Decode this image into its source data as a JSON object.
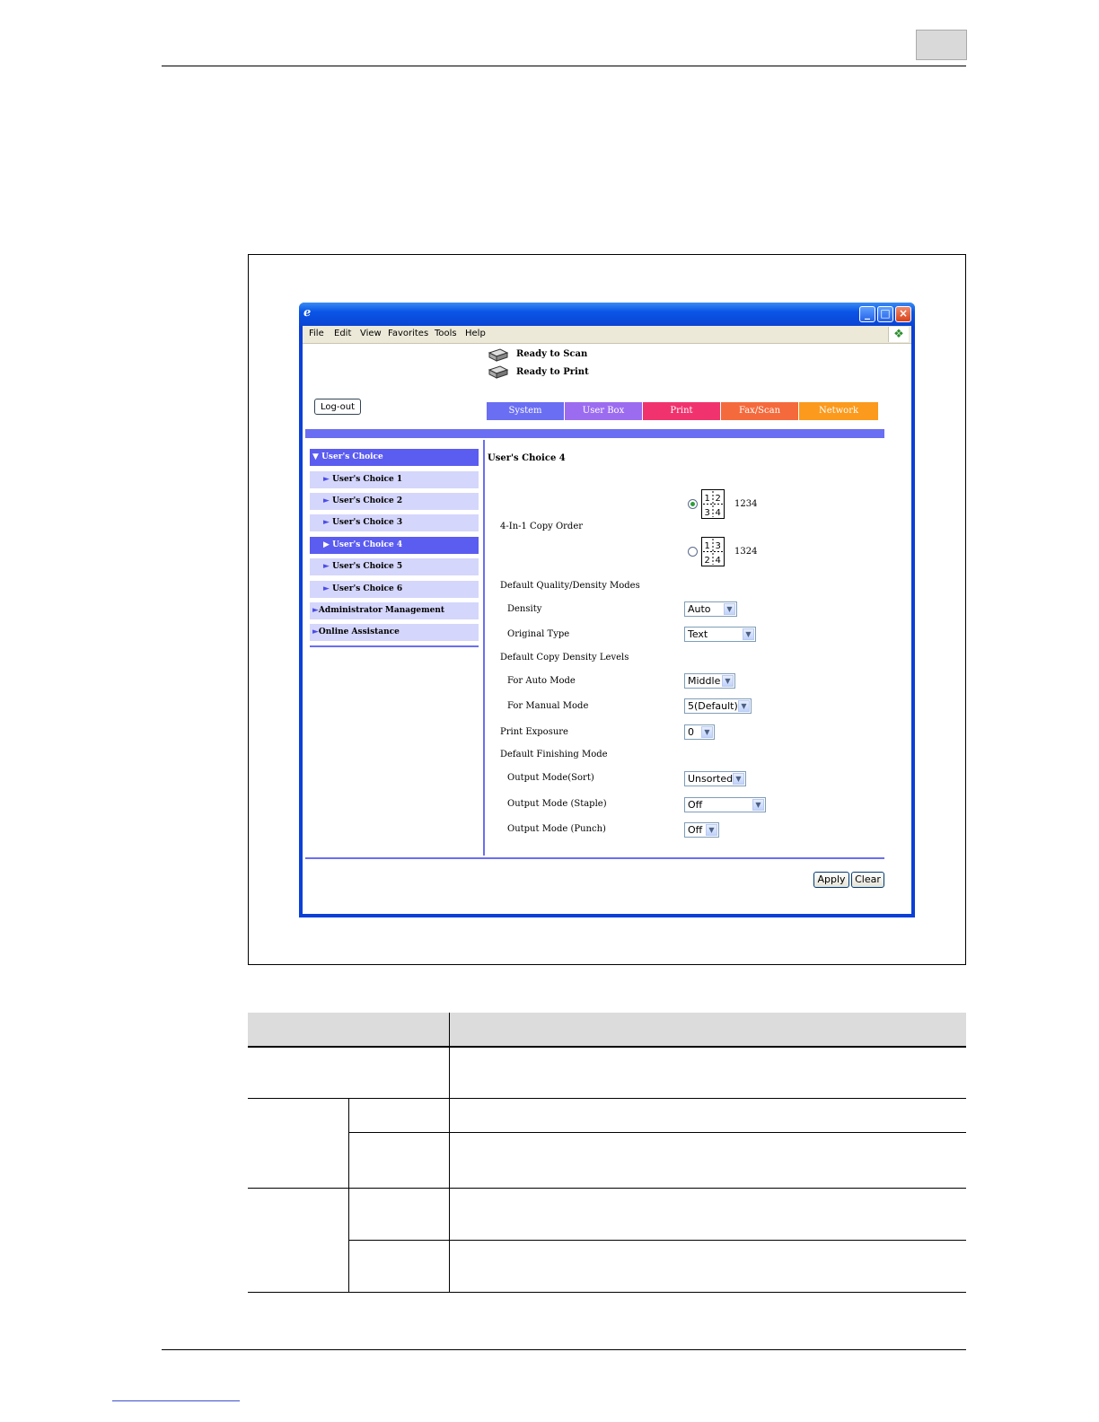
{
  "browser": {
    "menu": [
      "File",
      "Edit",
      "View",
      "Favorites",
      "Tools",
      "Help"
    ]
  },
  "status": {
    "scan": "Ready to Scan",
    "print": "Ready to Print"
  },
  "logout_label": "Log-out",
  "tabs": [
    {
      "label": "System",
      "color": "#6a6ef2"
    },
    {
      "label": "User Box",
      "color": "#9c6cf0"
    },
    {
      "label": "Print",
      "color": "#f0336e"
    },
    {
      "label": "Fax/Scan",
      "color": "#f56a3c"
    },
    {
      "label": "Network",
      "color": "#fb9a1c"
    }
  ],
  "nav": {
    "items": [
      {
        "label": "User's Choice",
        "marker": "▼"
      },
      {
        "label": "User's Choice 1",
        "marker": "►"
      },
      {
        "label": "User's Choice 2",
        "marker": "►"
      },
      {
        "label": "User's Choice 3",
        "marker": "►"
      },
      {
        "label": "User's Choice 4",
        "marker": "▶"
      },
      {
        "label": "User's Choice 5",
        "marker": "►"
      },
      {
        "label": "User's Choice 6",
        "marker": "►"
      },
      {
        "label": "Administrator Management",
        "marker": "►"
      },
      {
        "label": "Online Assistance",
        "marker": "►"
      }
    ]
  },
  "form": {
    "title": "User's Choice 4",
    "copy_order_label": "4-In-1 Copy Order",
    "order_options": [
      {
        "value": "1234",
        "cells": [
          "1",
          "2",
          "3",
          "4"
        ]
      },
      {
        "value": "1324",
        "cells": [
          "1",
          "3",
          "2",
          "4"
        ]
      }
    ],
    "quality_header": "Default Quality/Density Modes",
    "density_label": "Density",
    "density_value": "Auto",
    "original_type_label": "Original Type",
    "original_type_value": "Text",
    "copy_density_header": "Default Copy Density Levels",
    "auto_mode_label": "For Auto Mode",
    "auto_mode_value": "Middle",
    "manual_mode_label": "For Manual Mode",
    "manual_mode_value": "5(Default)",
    "print_exposure_label": "Print Exposure",
    "print_exposure_value": "0",
    "finishing_header": "Default Finishing Mode",
    "sort_label": "Output Mode(Sort)",
    "sort_value": "Unsorted",
    "staple_label": "Output Mode (Staple)",
    "staple_value": "Off",
    "punch_label": "Output Mode (Punch)",
    "punch_value": "Off",
    "apply_label": "Apply",
    "clear_label": "Clear"
  }
}
